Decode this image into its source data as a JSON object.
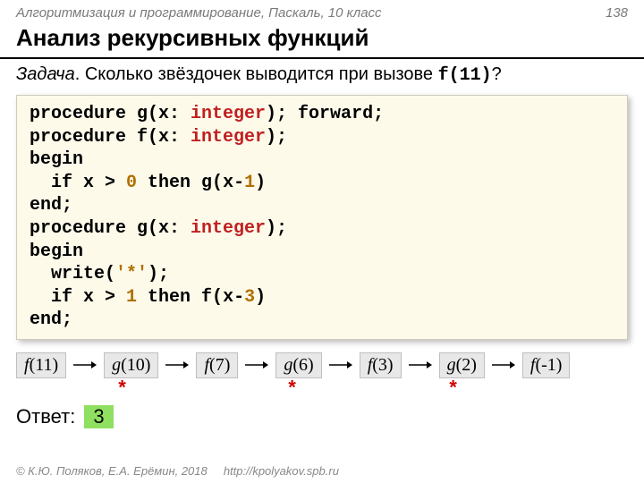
{
  "header": {
    "course": "Алгоритмизация и программирование, Паскаль, 10 класс",
    "page": "138"
  },
  "title": "Анализ рекурсивных функций",
  "task": {
    "label": "Задача",
    "text": ". Сколько звёздочек выводится при вызове ",
    "call": "f(11)",
    "q": "?"
  },
  "code": {
    "l1a": "procedure g(x: ",
    "l1b": "integer",
    "l1c": "); forward;",
    "l2a": "procedure f(x: ",
    "l2b": "integer",
    "l2c": ");",
    "l3": "begin",
    "l4a": "  if x > ",
    "l4n": "0",
    "l4b": " then g(x-",
    "l4n2": "1",
    "l4c": ")",
    "l5": "end;",
    "l6a": "procedure g(x: ",
    "l6b": "integer",
    "l6c": ");",
    "l7": "begin",
    "l8a": "  write(",
    "l8s": "'*'",
    "l8b": ");",
    "l9a": "  if x > ",
    "l9n": "1",
    "l9b": " then f(x-",
    "l9n2": "3",
    "l9c": ")",
    "l10": "end;"
  },
  "chain": [
    {
      "fn": "f",
      "arg": "(11)"
    },
    {
      "fn": "g",
      "arg": "(10)"
    },
    {
      "fn": "f",
      "arg": "(7)"
    },
    {
      "fn": "g",
      "arg": "(6)"
    },
    {
      "fn": "f",
      "arg": "(3)"
    },
    {
      "fn": "g",
      "arg": "(2)"
    },
    {
      "fn": "f",
      "arg": "(-1)"
    }
  ],
  "star": "*",
  "answer": {
    "label": "Ответ:",
    "value": "3"
  },
  "footer": {
    "copyright": "© К.Ю. Поляков, Е.А. Ерёмин, 2018",
    "url": "http://kpolyakov.spb.ru"
  }
}
